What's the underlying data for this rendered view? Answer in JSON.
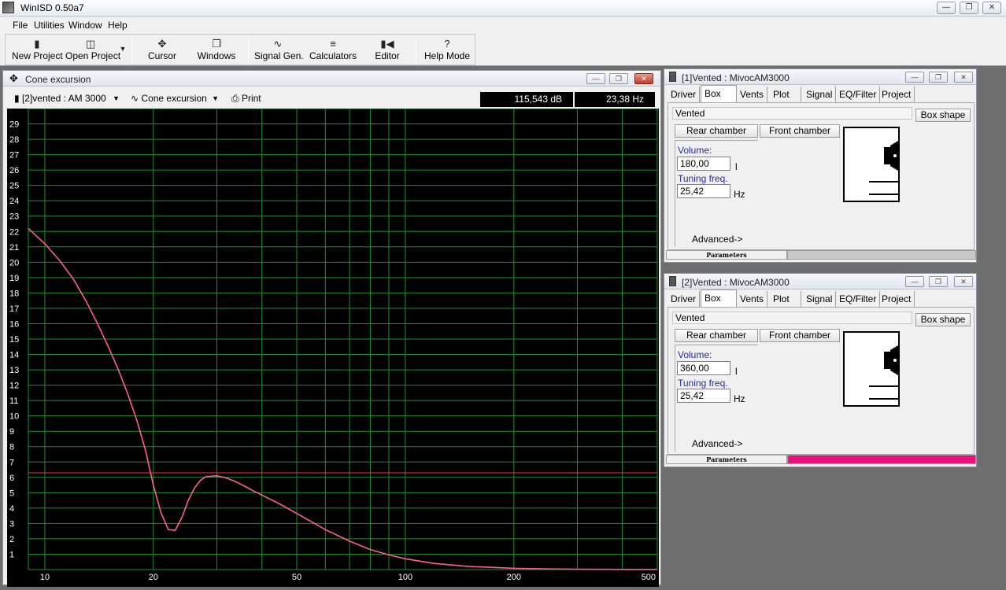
{
  "app": {
    "title": "WinISD 0.50a7"
  },
  "menu": [
    "File",
    "Utilities",
    "Window",
    "Help"
  ],
  "toolbar": {
    "buttons": [
      {
        "label": "New Project",
        "icon": "document-icon"
      },
      {
        "label": "Open Project",
        "icon": "folder-open-icon"
      },
      {
        "label": "Cursor",
        "icon": "crosshair-icon"
      },
      {
        "label": "Windows",
        "icon": "windows-icon"
      },
      {
        "label": "Signal Gen.",
        "icon": "sine-wave-icon"
      },
      {
        "label": "Calculators",
        "icon": "calculator-icon"
      },
      {
        "label": "Editor",
        "icon": "speaker-icon"
      },
      {
        "label": "Help Mode",
        "icon": "question-icon"
      }
    ]
  },
  "graph_window": {
    "title": "Cone excursion",
    "project_select": "[2]vented : AM 3000",
    "graph_select": "Cone excursion",
    "print_label": "Print",
    "readout_db": "115,543 dB",
    "readout_hz": "23,38 Hz"
  },
  "box_windows": [
    {
      "title": "[1]Vented : MivocAM3000",
      "tabs": [
        "Driver",
        "Box",
        "Vents",
        "Plot",
        "Signal",
        "EQ/Filter",
        "Project"
      ],
      "active_tab": "Box",
      "box_type": "Vented",
      "box_shape_label": "Box shape",
      "rear_chamber_label": "Rear chamber",
      "front_chamber_label": "Front chamber",
      "volume_label": "Volume:",
      "volume_value": "180,00",
      "volume_unit": "l",
      "tuning_label": "Tuning freq.",
      "tuning_value": "25,42",
      "tuning_unit": "Hz",
      "advanced_label": "Advanced->",
      "status_label": "Parameters",
      "status_color": "#c8c8c8"
    },
    {
      "title": "[2]Vented : MivocAM3000",
      "tabs": [
        "Driver",
        "Box",
        "Vents",
        "Plot",
        "Signal",
        "EQ/Filter",
        "Project"
      ],
      "active_tab": "Box",
      "box_type": "Vented",
      "box_shape_label": "Box shape",
      "rear_chamber_label": "Rear chamber",
      "front_chamber_label": "Front chamber",
      "volume_label": "Volume:",
      "volume_value": "360,00",
      "volume_unit": "l",
      "tuning_label": "Tuning freq.",
      "tuning_value": "25,42",
      "tuning_unit": "Hz",
      "advanced_label": "Advanced->",
      "status_label": "Parameters",
      "status_color": "#e8127a"
    }
  ],
  "chart_data": {
    "type": "line",
    "title": "",
    "xlabel": "",
    "ylabel": "",
    "x_scale": "log",
    "xlim": [
      9,
      500
    ],
    "ylim": [
      0,
      30
    ],
    "x_ticks": [
      10,
      20,
      50,
      100,
      200,
      500
    ],
    "y_ticks": [
      1,
      2,
      3,
      4,
      5,
      6,
      7,
      8,
      9,
      10,
      11,
      12,
      13,
      14,
      15,
      16,
      17,
      18,
      19,
      20,
      21,
      22,
      23,
      24,
      25,
      26,
      27,
      28,
      29
    ],
    "grid": true,
    "grid_color": "#1f8f2f",
    "background": "#000000",
    "cursor_y": 6.3,
    "cursor_color": "#ff2a55",
    "series": [
      {
        "color": "#ff5f8f",
        "x": [
          9,
          10,
          11,
          12,
          13,
          14,
          15,
          16,
          17,
          18,
          19,
          20,
          21,
          22,
          23,
          24,
          25,
          26,
          27,
          28,
          30,
          32,
          34,
          36,
          38,
          40,
          45,
          50,
          55,
          60,
          70,
          80,
          90,
          100,
          120,
          150,
          200,
          250,
          300,
          400,
          500
        ],
        "y": [
          22.2,
          21.2,
          20.1,
          18.9,
          17.5,
          16.0,
          14.5,
          13.0,
          11.4,
          9.7,
          7.8,
          5.5,
          3.7,
          2.6,
          2.55,
          3.4,
          4.5,
          5.3,
          5.8,
          6.05,
          6.1,
          5.95,
          5.7,
          5.4,
          5.1,
          4.85,
          4.25,
          3.65,
          3.1,
          2.6,
          1.85,
          1.3,
          0.95,
          0.7,
          0.4,
          0.2,
          0.08,
          0.04,
          0.02,
          0.01,
          0.01
        ]
      }
    ]
  }
}
